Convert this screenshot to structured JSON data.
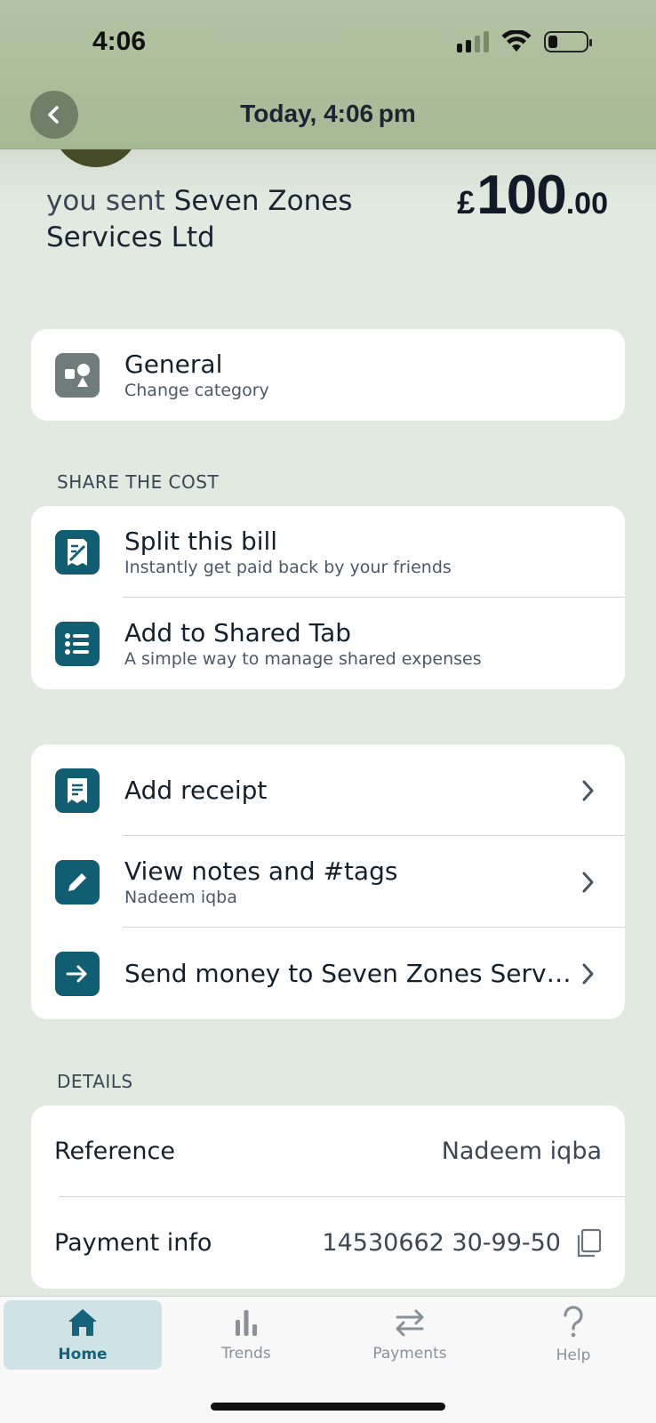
{
  "status_bar": {
    "time": "4:06"
  },
  "header": {
    "title": "Today, 4:06 pm"
  },
  "transaction": {
    "prefix": "you sent",
    "payee": "Seven Zones Services Ltd",
    "currency": "£",
    "amount_int": "100",
    "amount_dec": ".00"
  },
  "category": {
    "title": "General",
    "subtitle": "Change category"
  },
  "share": {
    "label": "SHARE THE COST",
    "items": [
      {
        "title": "Split this bill",
        "subtitle": "Instantly get paid back by your friends"
      },
      {
        "title": "Add to Shared Tab",
        "subtitle": "A simple way to manage shared expenses"
      }
    ]
  },
  "actions": [
    {
      "title": "Add receipt"
    },
    {
      "title": "View notes and #tags",
      "subtitle": "Nadeem iqba"
    },
    {
      "title": "Send money to Seven Zones Serv…"
    }
  ],
  "details": {
    "label": "DETAILS",
    "rows": [
      {
        "key": "Reference",
        "value": "Nadeem iqba"
      },
      {
        "key": "Payment info",
        "value": "14530662 30-99-50"
      }
    ]
  },
  "tabs": [
    {
      "label": "Home",
      "icon": "home-icon",
      "active": true
    },
    {
      "label": "Trends",
      "icon": "bar-chart-icon"
    },
    {
      "label": "Payments",
      "icon": "swap-arrows-icon"
    },
    {
      "label": "Help",
      "icon": "question-icon"
    }
  ],
  "colors": {
    "accent": "#115e73",
    "background": "#e1e9e0",
    "header": "#a6b995"
  }
}
